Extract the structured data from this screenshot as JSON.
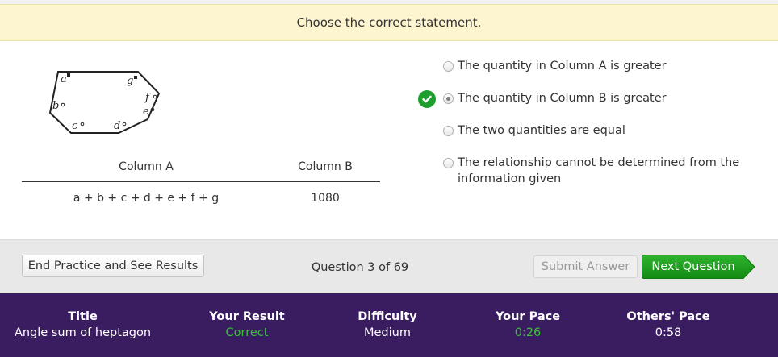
{
  "prompt": "Choose the correct statement.",
  "figure": {
    "angle_labels": [
      "a",
      "b",
      "c",
      "d",
      "e",
      "f",
      "g"
    ]
  },
  "comparison": {
    "column_a_header": "Column A",
    "column_b_header": "Column B",
    "column_a_value": "a + b + c + d + e + f + g",
    "column_b_value": "1080"
  },
  "options": [
    {
      "label": "The quantity in Column A is greater",
      "selected": false
    },
    {
      "label": "The quantity in Column B is greater",
      "selected": true,
      "marked_correct": true
    },
    {
      "label": "The two quantities are equal",
      "selected": false
    },
    {
      "label": "The relationship cannot be determined from the information given",
      "selected": false
    }
  ],
  "footer": {
    "end_button": "End Practice and See Results",
    "question_counter": "Question 3 of 69",
    "submit_button": "Submit Answer",
    "next_button": "Next Question"
  },
  "status": {
    "title_label": "Title",
    "title_value": "Angle sum of heptagon",
    "result_label": "Your Result",
    "result_value": "Correct",
    "difficulty_label": "Difficulty",
    "difficulty_value": "Medium",
    "pace_label": "Your Pace",
    "pace_value": "0:26",
    "others_pace_label": "Others' Pace",
    "others_pace_value": "0:58"
  },
  "colors": {
    "prompt_bg": "#fdf5cf",
    "next_button": "#1e9e1e",
    "status_bar_bg": "#3a1d60",
    "correct_green": "#3bbf3b"
  }
}
